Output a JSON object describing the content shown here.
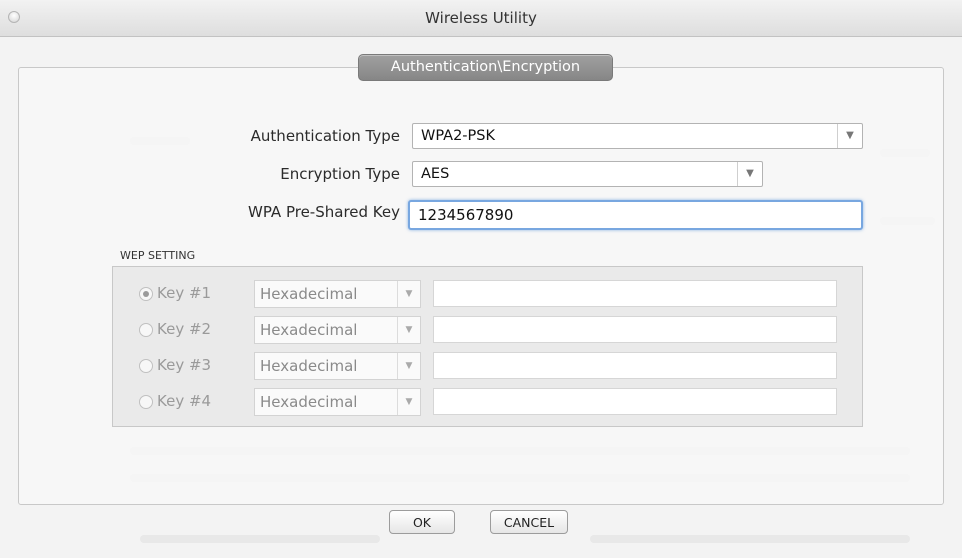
{
  "window": {
    "title": "Wireless Utility"
  },
  "panel": {
    "tab_label": "Authentication\\Encryption"
  },
  "form": {
    "auth_type_label": "Authentication Type",
    "auth_type_value": "WPA2-PSK",
    "enc_type_label": "Encryption Type",
    "enc_type_value": "AES",
    "psk_label": "WPA Pre-Shared Key",
    "psk_value": "1234567890"
  },
  "wep": {
    "group_label": "WEP SETTING",
    "keys": [
      {
        "label": "Key #1",
        "format": "Hexadecimal",
        "selected": true
      },
      {
        "label": "Key #2",
        "format": "Hexadecimal",
        "selected": false
      },
      {
        "label": "Key #3",
        "format": "Hexadecimal",
        "selected": false
      },
      {
        "label": "Key #4",
        "format": "Hexadecimal",
        "selected": false
      }
    ]
  },
  "buttons": {
    "ok_label": "OK",
    "cancel_label": "CANCEL"
  },
  "icons": {
    "dropdown": "chevron-down-icon",
    "window_control": "close-window-icon"
  },
  "colors": {
    "focus_ring": "#78a7e0",
    "tab_bg": "#8e8e8e",
    "disabled_text": "#9a9a9a"
  }
}
